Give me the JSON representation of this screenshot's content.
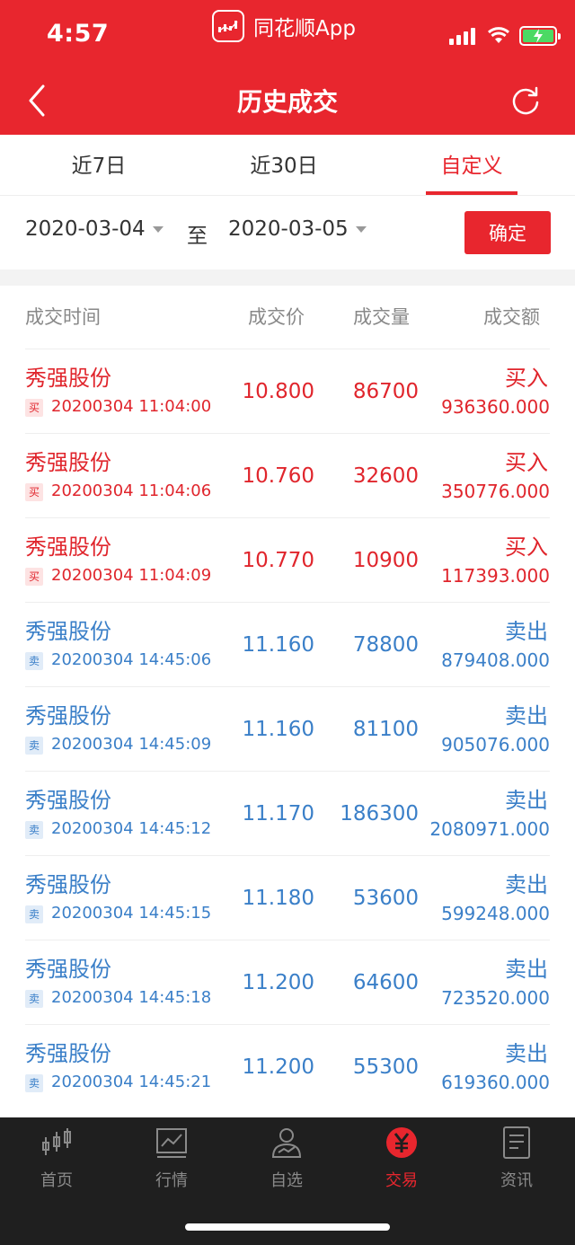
{
  "status": {
    "time": "4:57",
    "app_name": "同花顺App"
  },
  "nav": {
    "title": "历史成交",
    "back_icon": "chevron-left-icon",
    "refresh_icon": "refresh-icon"
  },
  "tabs": [
    {
      "label": "近7日",
      "active": false
    },
    {
      "label": "近30日",
      "active": false
    },
    {
      "label": "自定义",
      "active": true
    }
  ],
  "date_range": {
    "start": "2020-03-04",
    "to_label": "至",
    "end": "2020-03-05",
    "confirm_label": "确定"
  },
  "table": {
    "headers": [
      "成交时间",
      "成交价",
      "成交量",
      "成交额"
    ],
    "rows": [
      {
        "name": "秀强股份",
        "tag": "买",
        "time": "20200304 11:04:00",
        "price": "10.800",
        "volume": "86700",
        "side": "买入",
        "amount": "936360.000",
        "type": "buy"
      },
      {
        "name": "秀强股份",
        "tag": "买",
        "time": "20200304 11:04:06",
        "price": "10.760",
        "volume": "32600",
        "side": "买入",
        "amount": "350776.000",
        "type": "buy"
      },
      {
        "name": "秀强股份",
        "tag": "买",
        "time": "20200304 11:04:09",
        "price": "10.770",
        "volume": "10900",
        "side": "买入",
        "amount": "117393.000",
        "type": "buy"
      },
      {
        "name": "秀强股份",
        "tag": "卖",
        "time": "20200304 14:45:06",
        "price": "11.160",
        "volume": "78800",
        "side": "卖出",
        "amount": "879408.000",
        "type": "sell"
      },
      {
        "name": "秀强股份",
        "tag": "卖",
        "time": "20200304 14:45:09",
        "price": "11.160",
        "volume": "81100",
        "side": "卖出",
        "amount": "905076.000",
        "type": "sell"
      },
      {
        "name": "秀强股份",
        "tag": "卖",
        "time": "20200304 14:45:12",
        "price": "11.170",
        "volume": "186300",
        "side": "卖出",
        "amount": "2080971.000",
        "type": "sell"
      },
      {
        "name": "秀强股份",
        "tag": "卖",
        "time": "20200304 14:45:15",
        "price": "11.180",
        "volume": "53600",
        "side": "卖出",
        "amount": "599248.000",
        "type": "sell"
      },
      {
        "name": "秀强股份",
        "tag": "卖",
        "time": "20200304 14:45:18",
        "price": "11.200",
        "volume": "64600",
        "side": "卖出",
        "amount": "723520.000",
        "type": "sell"
      },
      {
        "name": "秀强股份",
        "tag": "卖",
        "time": "20200304 14:45:21",
        "price": "11.200",
        "volume": "55300",
        "side": "卖出",
        "amount": "619360.000",
        "type": "sell"
      }
    ]
  },
  "tabbar": [
    {
      "label": "首页",
      "icon": "candlestick-icon",
      "active": false
    },
    {
      "label": "行情",
      "icon": "line-chart-icon",
      "active": false
    },
    {
      "label": "自选",
      "icon": "user-chart-icon",
      "active": false
    },
    {
      "label": "交易",
      "icon": "yuan-icon",
      "active": true
    },
    {
      "label": "资讯",
      "icon": "document-icon",
      "active": false
    }
  ],
  "colors": {
    "brand_red": "#e8262e",
    "buy_red": "#e0252c",
    "sell_blue": "#3a7fc8",
    "tabbar_bg": "#1f1f1f"
  }
}
